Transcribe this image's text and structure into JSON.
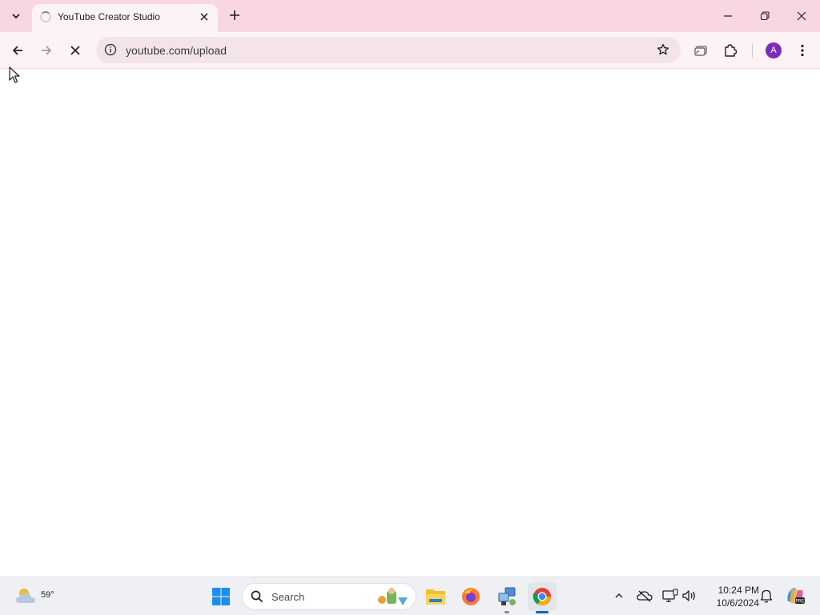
{
  "browser": {
    "tab": {
      "title": "YouTube Creator Studio",
      "loading": true
    },
    "address_bar": {
      "url": "youtube.com/upload"
    },
    "profile_initial": "A",
    "accent_color": "#f8d7e3"
  },
  "taskbar": {
    "weather": {
      "temperature": "59°"
    },
    "search": {
      "label": "Search"
    },
    "clock": {
      "time": "10:24 PM",
      "date": "10/6/2024"
    },
    "pinned_apps": [
      "start-icon",
      "search-icon",
      "file-explorer-icon",
      "firefox-icon",
      "network-app-icon",
      "chrome-icon"
    ],
    "tray_icons": [
      "chevron-up-icon",
      "onedrive-offline-icon",
      "display-icon",
      "speaker-icon",
      "notification-bell-icon",
      "copilot-icon"
    ]
  }
}
